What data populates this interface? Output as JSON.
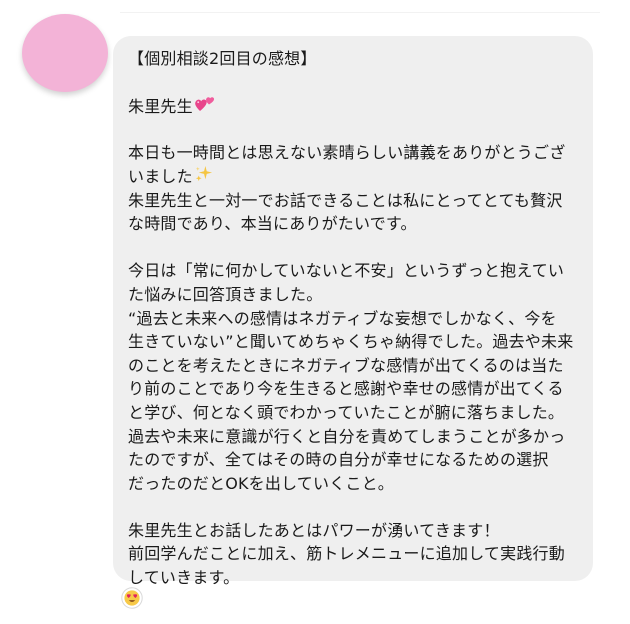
{
  "message": {
    "heading": "【個別相談2回目の感想】",
    "greeting": "朱里先生",
    "paragraph1": [
      "本日も一時間とは思えない素晴らしい講義をありがとうござ",
      "いました",
      "朱里先生と一対一でお話できることは私にとってとても贅沢",
      "な時間であり、本当にありがたいです。"
    ],
    "paragraph2": [
      "今日は「常に何かしていないと不安」というずっと抱えてい",
      "た悩みに回答頂きました。",
      "“過去と未来への感情はネガティブな妄想でしかなく、今を",
      "生きていない”と聞いてめちゃくちゃ納得でした。過去や未来",
      "のことを考えたときにネガティブな感情が出てくるのは当た",
      "り前のことであり今を生きると感謝や幸せの感情が出てくる",
      "と学び、何となく頭でわかっていたことが腑に落ちました。",
      "過去や未来に意識が行くと自分を責めてしまうことが多かっ",
      "たのですが、全てはその時の自分が幸せになるための選択",
      "だったのだとOKを出していくこと。"
    ],
    "paragraph3": [
      "朱里先生とお話したあとはパワーが湧いてきます！",
      "前回学んだことに加え、筋トレメニューに追加して実践行動",
      "していきます。"
    ]
  },
  "icons": {
    "heart": "two-hearts-icon",
    "sparkles": "sparkles-icon",
    "reaction": "heart-eyes-reaction-icon"
  },
  "colors": {
    "avatar": "#f3b3d7",
    "bubble": "#efefef",
    "text": "#1a1a1a"
  }
}
